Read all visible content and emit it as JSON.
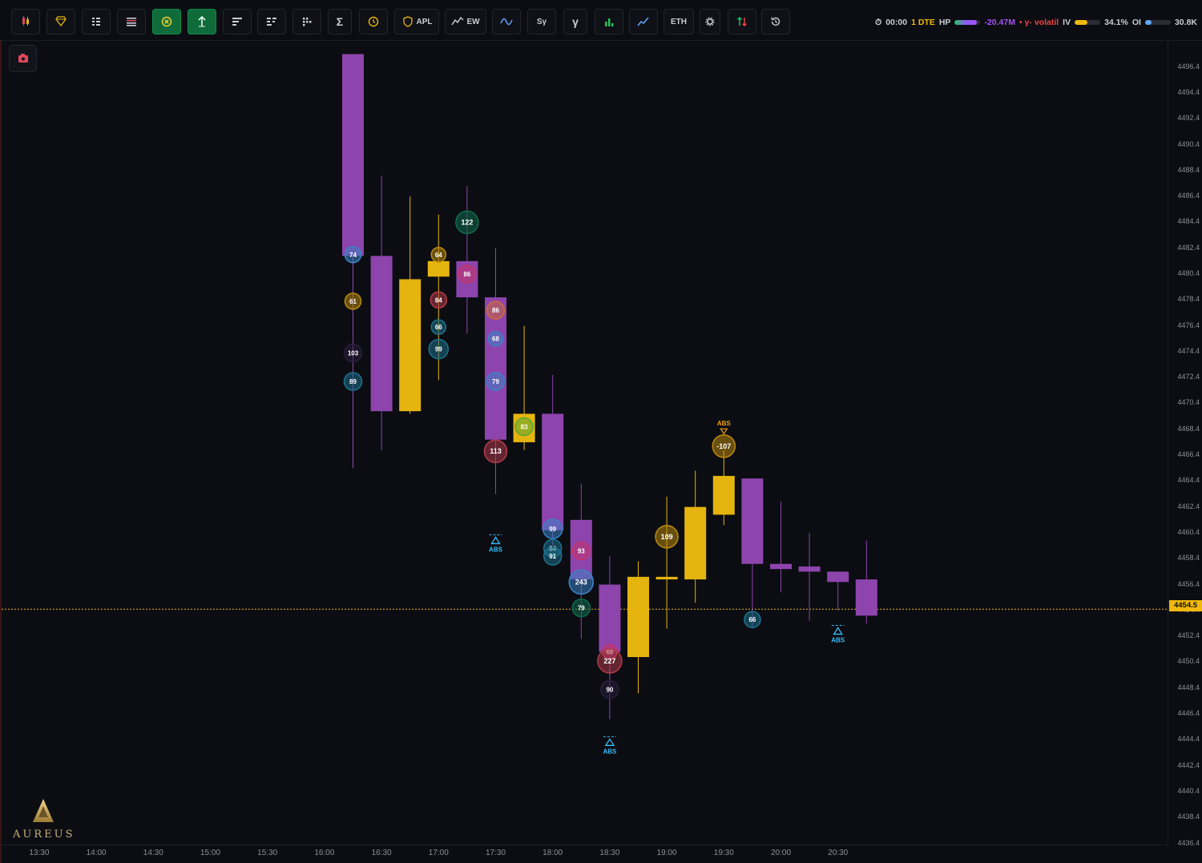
{
  "toolbar": {
    "buttons": [
      {
        "name": "candles-icon",
        "label": "",
        "icon": "candles-icon"
      },
      {
        "name": "diamond-icon",
        "label": "",
        "icon": "diamond-icon"
      },
      {
        "name": "grid-list-icon",
        "label": "",
        "icon": "grid-list-icon"
      },
      {
        "name": "lines-list-icon",
        "label": "",
        "icon": "lines-list-icon"
      },
      {
        "name": "x-circle-toggle",
        "label": "",
        "icon": "x-circle-icon",
        "active": true
      },
      {
        "name": "arrow-up-toggle",
        "label": "",
        "icon": "arrow-up-icon",
        "active": true
      },
      {
        "name": "bars-left-icon",
        "label": "",
        "icon": "bars-left-icon"
      },
      {
        "name": "bars-split-icon",
        "label": "",
        "icon": "bars-split-icon"
      },
      {
        "name": "dots-grid-icon",
        "label": "",
        "icon": "dots-grid-icon"
      },
      {
        "name": "sigma-button",
        "label": "Σ",
        "icon": "sigma-icon"
      },
      {
        "name": "clock-icon",
        "label": "",
        "icon": "clock-icon"
      },
      {
        "name": "apl-button",
        "label": "APL",
        "icon": "shield-icon"
      },
      {
        "name": "ew-button",
        "label": "EW",
        "icon": "trend-icon"
      },
      {
        "name": "wave-button",
        "label": "",
        "icon": "wave-icon"
      },
      {
        "name": "sy-button",
        "label": "Sγ",
        "icon": ""
      },
      {
        "name": "gamma-button",
        "label": "γ",
        "icon": ""
      },
      {
        "name": "bar-chart-button",
        "label": "",
        "icon": "bar-chart-icon"
      },
      {
        "name": "line-chart-button",
        "label": "",
        "icon": "line-chart-icon"
      },
      {
        "name": "eth-button",
        "label": "ETH",
        "icon": ""
      },
      {
        "name": "settings-button",
        "label": "",
        "icon": "gear-icon"
      },
      {
        "name": "sort-button",
        "label": "",
        "icon": "up-down-arrows-icon"
      },
      {
        "name": "history-button",
        "label": "",
        "icon": "history-icon"
      }
    ]
  },
  "status": {
    "time": "00:00",
    "dte": "1 DTE",
    "hp_label": "HP",
    "hp_fill": 0.85,
    "hp_value": "-20.47M",
    "gamma_label": "• γ- volatil",
    "iv_label": "IV",
    "iv_fill": 0.5,
    "iv_value": "34.1%",
    "oi_label": "OI",
    "oi_fill": 0.25,
    "oi_value": "30.8K",
    "colors": {
      "time": "#c9ced6",
      "dte": "#f0b90b",
      "hp": "#a855f7",
      "gamma": "#ef4444",
      "iv": "#c9ced6"
    }
  },
  "brand": {
    "name": "AUREUS"
  },
  "current_price": {
    "value": 4454.5,
    "label": "4454.5",
    "color": "#f0b90b"
  },
  "y_axis": {
    "min": 4436.4,
    "max": 4497.4,
    "ticks": [
      "4496.4",
      "4494.4",
      "4492.4",
      "4490.4",
      "4488.4",
      "4486.4",
      "4484.4",
      "4482.4",
      "4480.4",
      "4478.4",
      "4476.4",
      "4474.4",
      "4472.4",
      "4470.4",
      "4468.4",
      "4466.4",
      "4464.4",
      "4462.4",
      "4460.4",
      "4458.4",
      "4456.4",
      "4454.4",
      "4452.4",
      "4450.4",
      "4448.4",
      "4446.4",
      "4444.4",
      "4442.4",
      "4440.4",
      "4438.4",
      "4436.4"
    ]
  },
  "x_axis": {
    "ticks": [
      {
        "label": "13:30",
        "slot": -1
      },
      {
        "label": "14:00",
        "slot": 1
      },
      {
        "label": "14:30",
        "slot": 3
      },
      {
        "label": "15:00",
        "slot": 5
      },
      {
        "label": "15:30",
        "slot": 7
      },
      {
        "label": "16:00",
        "slot": 9
      },
      {
        "label": "16:30",
        "slot": 11
      },
      {
        "label": "17:00",
        "slot": 13
      },
      {
        "label": "17:30",
        "slot": 15
      },
      {
        "label": "18:00",
        "slot": 17
      },
      {
        "label": "18:30",
        "slot": 19
      },
      {
        "label": "19:00",
        "slot": 21
      },
      {
        "label": "19:30",
        "slot": 23
      },
      {
        "label": "20:00",
        "slot": 25
      },
      {
        "label": "20:30",
        "slot": 27
      }
    ]
  },
  "chart_data": {
    "type": "candlestick",
    "up_color": "#e6b40f",
    "down_color": "#8e44ad",
    "candles": [
      {
        "slot": 10,
        "o": 4497.4,
        "h": 4497.4,
        "l": 4465.4,
        "c": 4481.8
      },
      {
        "slot": 11,
        "o": 4481.8,
        "h": 4488.0,
        "l": 4466.8,
        "c": 4469.8
      },
      {
        "slot": 12,
        "o": 4469.8,
        "h": 4486.4,
        "l": 4469.6,
        "c": 4480.0
      },
      {
        "slot": 13,
        "o": 4480.2,
        "h": 4485.0,
        "l": 4472.2,
        "c": 4481.4
      },
      {
        "slot": 14,
        "o": 4481.4,
        "h": 4487.2,
        "l": 4475.8,
        "c": 4478.6
      },
      {
        "slot": 15,
        "o": 4478.6,
        "h": 4482.4,
        "l": 4463.4,
        "c": 4467.6
      },
      {
        "slot": 16,
        "o": 4467.4,
        "h": 4476.4,
        "l": 4466.8,
        "c": 4469.6
      },
      {
        "slot": 17,
        "o": 4469.6,
        "h": 4472.6,
        "l": 4459.4,
        "c": 4460.6
      },
      {
        "slot": 18,
        "o": 4461.4,
        "h": 4464.2,
        "l": 4452.2,
        "c": 4456.8
      },
      {
        "slot": 19,
        "o": 4456.4,
        "h": 4458.6,
        "l": 4446.0,
        "c": 4451.2
      },
      {
        "slot": 20,
        "o": 4450.8,
        "h": 4458.2,
        "l": 4448.0,
        "c": 4457.0
      },
      {
        "slot": 21,
        "o": 4456.8,
        "h": 4463.2,
        "l": 4453.0,
        "c": 4457.0
      },
      {
        "slot": 22,
        "o": 4456.8,
        "h": 4465.2,
        "l": 4455.0,
        "c": 4462.4
      },
      {
        "slot": 23,
        "o": 4461.8,
        "h": 4466.8,
        "l": 4461.0,
        "c": 4464.8
      },
      {
        "slot": 24,
        "o": 4464.6,
        "h": 4464.6,
        "l": 4453.0,
        "c": 4458.0
      },
      {
        "slot": 25,
        "o": 4458.0,
        "h": 4462.8,
        "l": 4455.8,
        "c": 4457.6
      },
      {
        "slot": 26,
        "o": 4457.8,
        "h": 4460.4,
        "l": 4453.6,
        "c": 4457.4
      },
      {
        "slot": 27,
        "o": 4457.4,
        "h": 4457.4,
        "l": 4454.4,
        "c": 4456.6
      },
      {
        "slot": 28,
        "o": 4456.8,
        "h": 4459.8,
        "l": 4453.4,
        "c": 4454.0
      }
    ],
    "markers": [
      {
        "slot": 10,
        "price": 4481.9,
        "label": "74",
        "color": "#3b82c4",
        "r": 10
      },
      {
        "slot": 10,
        "price": 4478.3,
        "label": "61",
        "color": "#b8860b",
        "r": 10
      },
      {
        "slot": 10,
        "price": 4474.3,
        "label": "103",
        "color": "#2a1d3a",
        "r": 11
      },
      {
        "slot": 10,
        "price": 4472.1,
        "label": "89",
        "color": "#1d6f8a",
        "r": 11
      },
      {
        "slot": 13,
        "price": 4481.9,
        "label": "64",
        "color": "#b8860b",
        "r": 9
      },
      {
        "slot": 13,
        "price": 4478.4,
        "label": "84",
        "color": "#b03a48",
        "r": 10
      },
      {
        "slot": 13,
        "price": 4476.3,
        "label": "66",
        "color": "#1d6f8a",
        "r": 9
      },
      {
        "slot": 13,
        "price": 4474.6,
        "label": "99",
        "color": "#1d6f8a",
        "r": 12
      },
      {
        "slot": 14,
        "price": 4484.4,
        "label": "122",
        "color": "#0f6b4a",
        "r": 14
      },
      {
        "slot": 14,
        "price": 4480.4,
        "label": "86",
        "color": "#c2356c",
        "r": 11
      },
      {
        "slot": 15,
        "price": 4477.6,
        "label": "86",
        "color": "#c96a3e",
        "r": 11
      },
      {
        "slot": 15,
        "price": 4475.4,
        "label": "68",
        "color": "#3b82c4",
        "r": 9
      },
      {
        "slot": 15,
        "price": 4472.1,
        "label": "79",
        "color": "#3b82c4",
        "r": 11
      },
      {
        "slot": 15,
        "price": 4466.7,
        "label": "113",
        "color": "#b03a48",
        "r": 14
      },
      {
        "slot": 16,
        "price": 4468.6,
        "label": "83",
        "color": "#5aa832",
        "r": 11
      },
      {
        "slot": 17,
        "price": 4460.7,
        "label": "99",
        "color": "#3b82c4",
        "r": 12
      },
      {
        "slot": 17,
        "price": 4459.2,
        "label": "84",
        "color": "#1d6f8a",
        "r": 11
      },
      {
        "slot": 17,
        "price": 4458.6,
        "label": "91",
        "color": "#1d6f8a",
        "r": 11
      },
      {
        "slot": 18,
        "price": 4459.0,
        "label": "93",
        "color": "#c2356c",
        "r": 11
      },
      {
        "slot": 18,
        "price": 4456.6,
        "label": "243",
        "color": "#3b82c4",
        "r": 15
      },
      {
        "slot": 18,
        "price": 4454.6,
        "label": "79",
        "color": "#0f6b4a",
        "r": 11
      },
      {
        "slot": 19,
        "price": 4451.2,
        "label": "68",
        "color": "#c2356c",
        "r": 9
      },
      {
        "slot": 19,
        "price": 4450.5,
        "label": "227",
        "color": "#b03a48",
        "r": 15
      },
      {
        "slot": 19,
        "price": 4448.3,
        "label": "90",
        "color": "#2a1d3a",
        "r": 11
      },
      {
        "slot": 21,
        "price": 4460.1,
        "label": "109",
        "color": "#b8860b",
        "r": 14
      },
      {
        "slot": 23,
        "price": 4467.1,
        "label": "-107",
        "color": "#b8860b",
        "r": 14
      },
      {
        "slot": 24,
        "price": 4453.7,
        "label": "66",
        "color": "#1d6f8a",
        "r": 10
      }
    ],
    "abs_labels": [
      {
        "slot": 15,
        "price": 4460.0,
        "label": "ABS",
        "color": "#38bdf8",
        "dir": "up"
      },
      {
        "slot": 19,
        "price": 4444.4,
        "label": "ABS",
        "color": "#38bdf8",
        "dir": "up"
      },
      {
        "slot": 23,
        "price": 4468.5,
        "label": "ABS",
        "color": "#f59e0b",
        "dir": "down"
      },
      {
        "slot": 27,
        "price": 4453.0,
        "label": "ABS",
        "color": "#38bdf8",
        "dir": "up"
      }
    ]
  }
}
